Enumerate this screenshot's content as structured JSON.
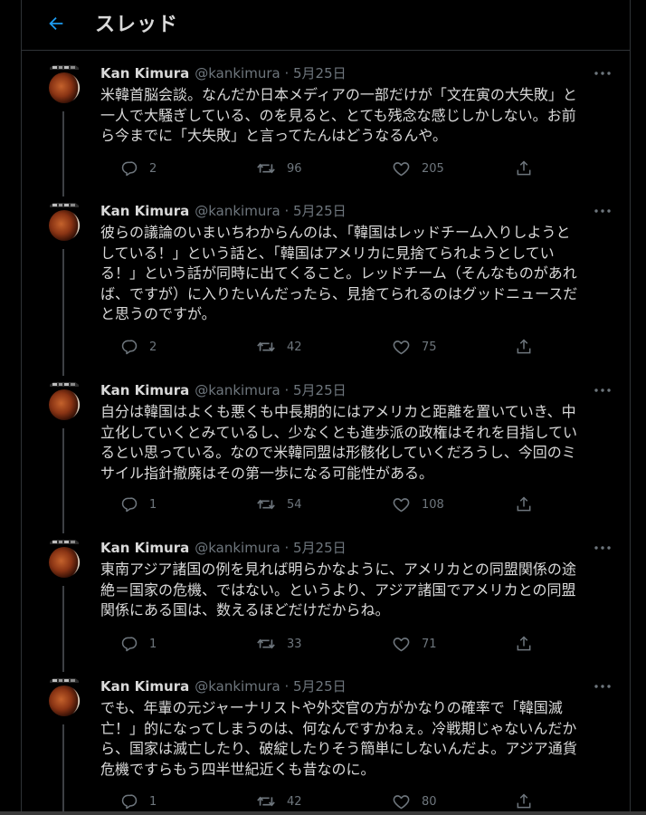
{
  "header": {
    "title": "スレッド",
    "back_icon": "arrow-left-icon",
    "accent": "#1d9bf0"
  },
  "tweets": [
    {
      "name": "Kan Kimura",
      "meta": "@kankimura · 5月25日",
      "text": "米韓首脳会談。なんだか日本メディアの一部だけが「文在寅の大失敗」と\n一人で大騒ぎしている、のを見ると、とても残念な感じしかしない。お前\nら今までに「大失敗」と言ってたんはどうなるんや。",
      "replies": "2",
      "retweets": "96",
      "likes": "205"
    },
    {
      "name": "Kan Kimura",
      "meta": "@kankimura · 5月25日",
      "text": "彼らの議論のいまいちわからんのは、「韓国はレッドチーム入りしようと\nしている！」という話と、「韓国はアメリカに見捨てられようとしてい\nる！」という話が同時に出てくること。レッドチーム（そんなものがあれ\nば、ですが）に入りたいんだったら、見捨てられるのはグッドニュースだ\nと思うのですが。",
      "replies": "2",
      "retweets": "42",
      "likes": "75"
    },
    {
      "name": "Kan Kimura",
      "meta": "@kankimura · 5月25日",
      "text": "自分は韓国はよくも悪くも中長期的にはアメリカと距離を置いていき、中\n立化していくとみているし、少なくとも進歩派の政権はそれを目指してい\nるとい思っている。なので米韓同盟は形骸化していくだろうし、今回のミ\nサイル指針撤廃はその第一歩になる可能性がある。",
      "replies": "1",
      "retweets": "54",
      "likes": "108"
    },
    {
      "name": "Kan Kimura",
      "meta": "@kankimura · 5月25日",
      "text": "東南アジア諸国の例を見れば明らかなように、アメリカとの同盟関係の途\n絶＝国家の危機、ではない。というより、アジア諸国でアメリカとの同盟\n関係にある国は、数えるほどだけだからね。",
      "replies": "1",
      "retweets": "33",
      "likes": "71"
    },
    {
      "name": "Kan Kimura",
      "meta": "@kankimura · 5月25日",
      "text": "でも、年輩の元ジャーナリストや外交官の方がかなりの確率で「韓国滅\n亡！」的になってしまうのは、何なんですかねぇ。冷戦期じゃないんだか\nら、国家は滅亡したり、破綻したりそう簡単にしないんだよ。アジア通貨\n危機ですらもう四半世紀近くも昔なのに。",
      "replies": "1",
      "retweets": "42",
      "likes": "80"
    }
  ]
}
